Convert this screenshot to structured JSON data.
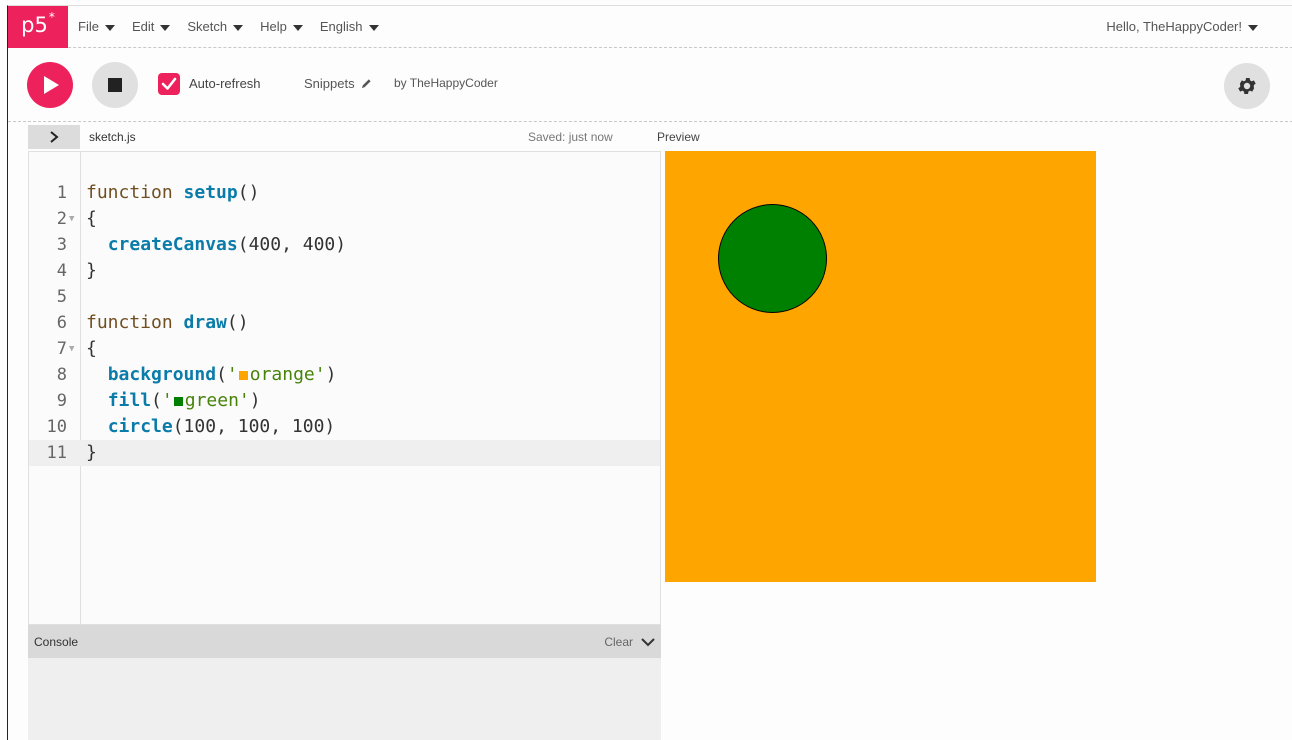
{
  "brand": {
    "logo": "p5",
    "logo_sup": "*"
  },
  "menu": [
    "File",
    "Edit",
    "Sketch",
    "Help",
    "English"
  ],
  "user": {
    "greeting": "Hello, TheHappyCoder!"
  },
  "toolbar": {
    "auto_refresh_label": "Auto-refresh",
    "auto_refresh_checked": true,
    "sketch_name": "Snippets",
    "author": "by TheHappyCoder"
  },
  "editor": {
    "file_name": "sketch.js",
    "status": "Saved: just now",
    "active_line": 11,
    "line_numbers": [
      "1",
      "2",
      "3",
      "4",
      "5",
      "6",
      "7",
      "8",
      "9",
      "10",
      "11"
    ],
    "folds": [
      2,
      7
    ]
  },
  "preview": {
    "label": "Preview",
    "background_color": "#ffa500",
    "circle_color": "#008000"
  },
  "console": {
    "label": "Console",
    "clear_label": "Clear"
  },
  "colors": {
    "accent": "#ed225d",
    "keyword": "#704f21",
    "function": "#0b7ca9",
    "string": "#47820a"
  }
}
